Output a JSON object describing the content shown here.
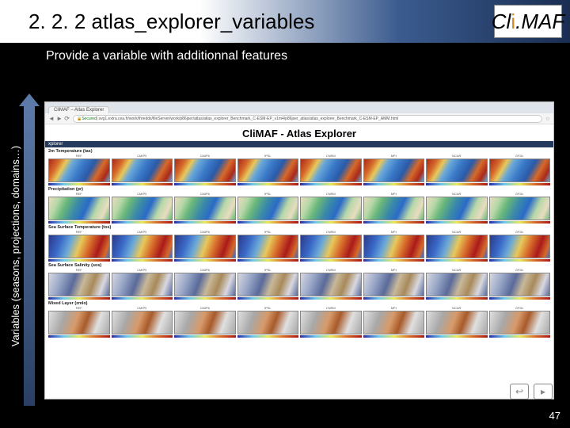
{
  "title": "2. 2. 2 atlas_explorer_variables",
  "subtitle": "Provide a variable with additionnal features",
  "side_label": "Variables (seasons, projections, domains…)",
  "logo": {
    "pre": "Cl",
    "dot": "i",
    "post": ".MAF"
  },
  "browser": {
    "tab_label": "CliMAF – Atlas Explorer",
    "secure": "Secured",
    "url_rest": " | svg1.extra.cea.fr/work/thredds/fileServer/work/p86jser/atlas/atlas_explorer_Benchmark_C-ESM-EP_v1m4/p86jser_atlas/atlas_explorer_Benchmark_C-ESM-EP_AMM.html",
    "page_title": "CliMAF - Atlas Explorer",
    "section": "xplorer",
    "cols": [
      "REF",
      "CMIP5",
      "CMIP6",
      "IPSL",
      "CNRM",
      "MPI",
      "NCAR",
      "GFDL"
    ],
    "vars": [
      {
        "label": "2m Temperature (tas)",
        "style": "warm"
      },
      {
        "label": "Precipitation (pr)",
        "style": "precip"
      },
      {
        "label": "Sea Surface Temperature (tos)",
        "style": "sst"
      },
      {
        "label": "Sea Surface Salinity (sos)",
        "style": "sal"
      },
      {
        "label": "Mixed Layer (zmlo)",
        "style": "thk"
      }
    ]
  },
  "page_number": "47"
}
